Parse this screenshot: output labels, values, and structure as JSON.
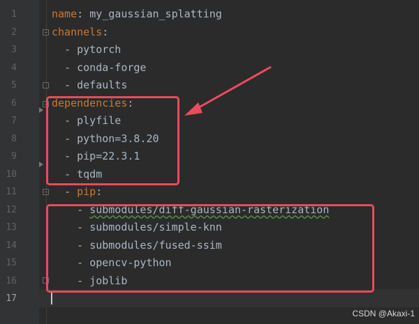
{
  "editor": {
    "current_line": 17,
    "lines": [
      {
        "n": "1",
        "key": "name",
        "sep": ": ",
        "val": "my_gaussian_splatting"
      },
      {
        "n": "2",
        "key": "channels",
        "sep": ":",
        "val": ""
      },
      {
        "n": "3",
        "indent": "  ",
        "dash": "- ",
        "val": "pytorch"
      },
      {
        "n": "4",
        "indent": "  ",
        "dash": "- ",
        "val": "conda-forge"
      },
      {
        "n": "5",
        "indent": "  ",
        "dash": "- ",
        "val": "defaults"
      },
      {
        "n": "6",
        "key": "dependencies",
        "sep": ":",
        "val": ""
      },
      {
        "n": "7",
        "indent": "  ",
        "dash": "- ",
        "val": "plyfile"
      },
      {
        "n": "8",
        "indent": "  ",
        "dash": "- ",
        "val": "python=3.8.20"
      },
      {
        "n": "9",
        "indent": "  ",
        "dash": "- ",
        "val": "pip=22.3.1"
      },
      {
        "n": "10",
        "indent": "  ",
        "dash": "- ",
        "val": "tqdm"
      },
      {
        "n": "11",
        "indent": "  ",
        "dash": "- ",
        "key": "pip",
        "sep": ":",
        "val": ""
      },
      {
        "n": "12",
        "indent": "    ",
        "dash": "- ",
        "val": "submodules/diff-gaussian-rasterization"
      },
      {
        "n": "13",
        "indent": "    ",
        "dash": "- ",
        "val": "submodules/simple-knn"
      },
      {
        "n": "14",
        "indent": "    ",
        "dash": "- ",
        "val": "submodules/fused-ssim"
      },
      {
        "n": "15",
        "indent": "    ",
        "dash": "- ",
        "val": "opencv-python"
      },
      {
        "n": "16",
        "indent": "    ",
        "dash": "- ",
        "val": "joblib"
      },
      {
        "n": "17",
        "val": ""
      }
    ]
  },
  "watermark": "CSDN @Akaxi-1",
  "colors": {
    "background": "#2b2b2b",
    "key": "#cc7832",
    "text": "#a9b7c6",
    "annotation": "#ec4a5e"
  }
}
